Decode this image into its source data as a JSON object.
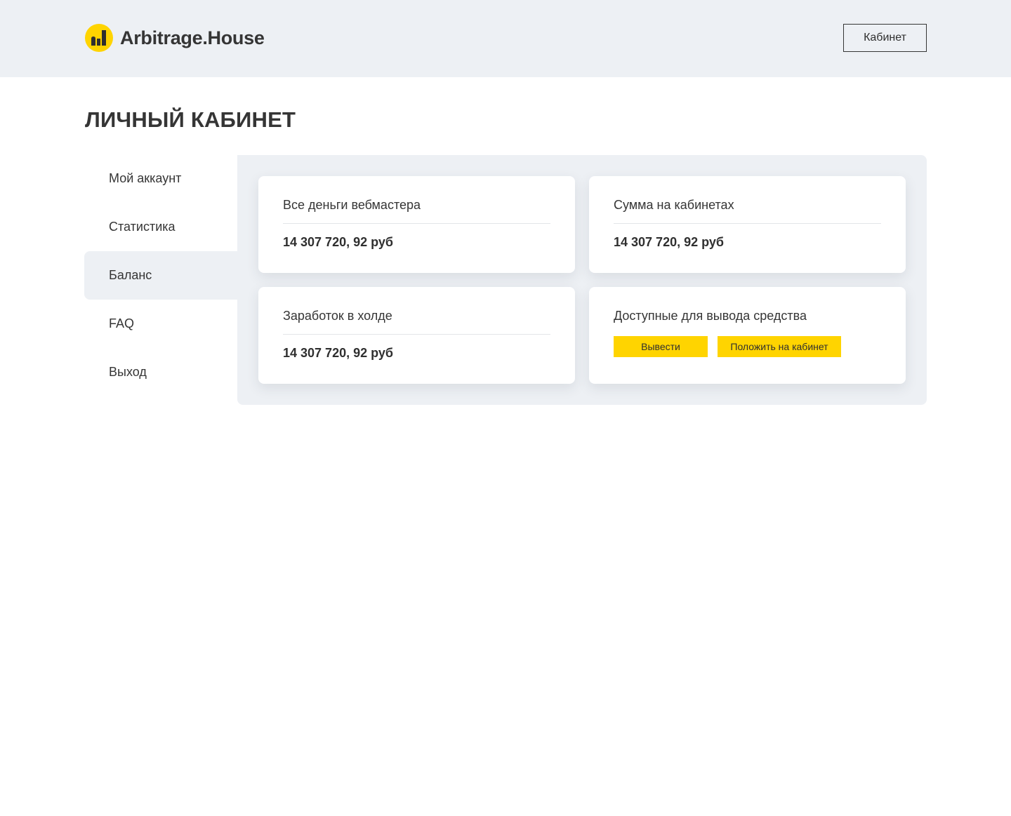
{
  "header": {
    "brand": "Arbitrage.House",
    "logo_icon": "bar-chart-logo-icon",
    "brand_color": "#ffd400",
    "cabinet_button": "Кабинет"
  },
  "page": {
    "title": "ЛИЧНЫЙ КАБИНЕТ"
  },
  "sidebar": {
    "items": [
      {
        "label": "Мой аккаунт",
        "active": false
      },
      {
        "label": "Статистика",
        "active": false
      },
      {
        "label": "Баланс",
        "active": true
      },
      {
        "label": "FAQ",
        "active": false
      },
      {
        "label": "Выход",
        "active": false
      }
    ]
  },
  "balance": {
    "cards": [
      {
        "label": "Все деньги вебмастера",
        "value": "14 307 720, 92 руб"
      },
      {
        "label": "Сумма на кабинетах",
        "value": "14 307 720, 92 руб"
      },
      {
        "label": "Заработок в холде",
        "value": "14 307 720, 92 руб"
      }
    ],
    "available": {
      "label": "Доступные для вывода средства",
      "withdraw_button": "Вывести",
      "deposit_button": "Положить на кабинет"
    }
  }
}
